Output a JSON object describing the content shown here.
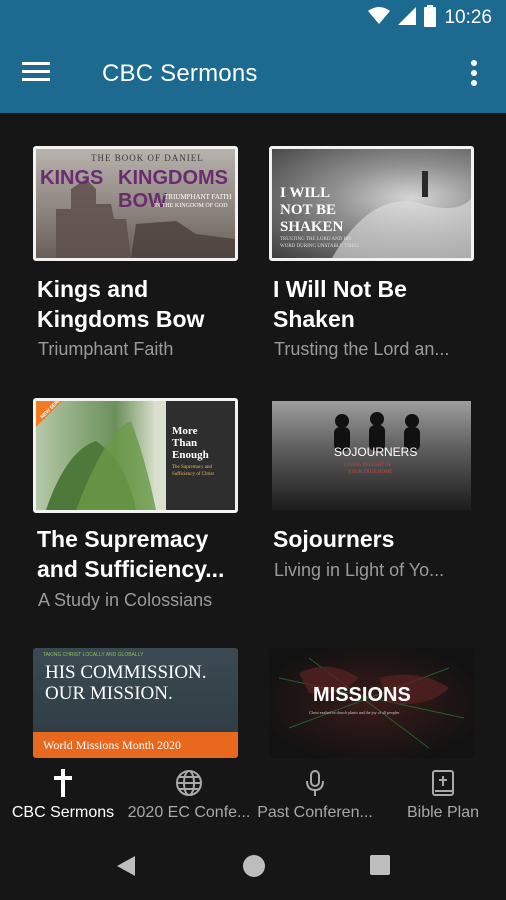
{
  "status_bar": {
    "time": "10:26"
  },
  "app_bar": {
    "title": "CBC Sermons"
  },
  "thumbnails": {
    "kings": {
      "line1": "THE BOOK OF DANIEL",
      "line2": "KINGS",
      "line3": "KINGDOMS BOW",
      "line4": "TRIUMPHANT FAITH",
      "line5": "IN THE KINGDOM OF GOD"
    },
    "shaken": {
      "line1": "I WILL",
      "line2": "NOT BE",
      "line3": "SHAKEN",
      "line4": "TRUSTING THE LORD AND HIS",
      "line5": "WORD DURING UNSTABLE TIMES"
    },
    "supremacy": {
      "badge": "NEW SERIES",
      "line1": "More",
      "line2": "Than",
      "line3": "Enough",
      "line4": "The Supremacy and",
      "line5": "Sufficiency of Christ"
    },
    "sojourners": {
      "line1": "SOJOURNERS",
      "line2": "LIVING IN LIGHT OF",
      "line3": "YOUR TRUE HOME"
    },
    "commission": {
      "top": "TAKING CHRIST LOCALLY AND GLOBALLY",
      "line1": "HIS COMMISSION.",
      "line2": "OUR MISSION.",
      "footer": "World Missions Month 2020"
    },
    "missions": {
      "line1": "MISSIONS",
      "line2": "Christ exalted in church plants and the joy of all peoples"
    }
  },
  "cards": [
    {
      "title_line1": "Kings and",
      "title_line2": "Kingdoms Bow",
      "subtitle": "Triumphant Faith"
    },
    {
      "title_line1": "I Will Not Be",
      "title_line2": "Shaken",
      "subtitle": "Trusting the Lord an..."
    },
    {
      "title_line1": "The Supremacy",
      "title_line2": "and Sufficiency...",
      "subtitle": "A Study in Colossians"
    },
    {
      "title_line1": "Sojourners",
      "title_line2": "",
      "subtitle": "Living in Light of Yo..."
    }
  ],
  "bottom_nav": [
    {
      "label": "CBC Sermons",
      "icon": "cross-icon",
      "active": true
    },
    {
      "label": "2020 EC Confe...",
      "icon": "globe-icon",
      "active": false
    },
    {
      "label": "Past Conferen...",
      "icon": "microphone-icon",
      "active": false
    },
    {
      "label": "Bible Plan",
      "icon": "bible-icon",
      "active": false
    }
  ],
  "colors": {
    "app_bar": "#1c6a8f",
    "background": "#161616",
    "subtitle": "#9a9a9a"
  }
}
